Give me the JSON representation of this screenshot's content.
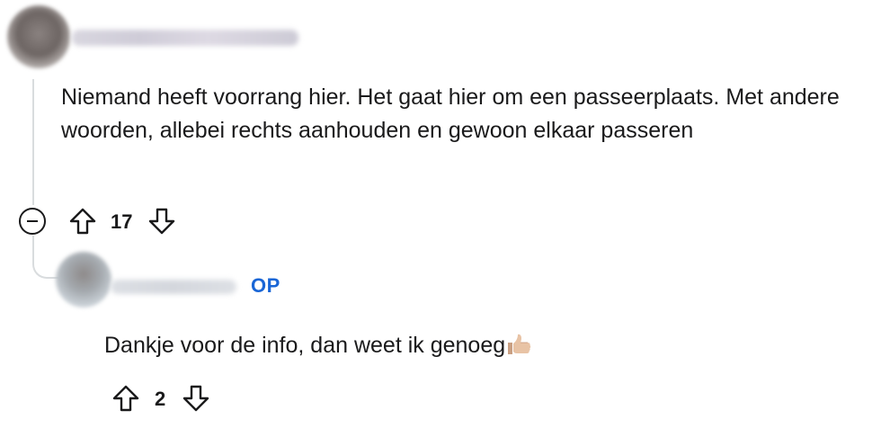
{
  "comments": [
    {
      "text": "Niemand heeft voorrang hier. Het gaat hier om een passeerplaats. Met andere woorden, allebei rechts aanhouden en gewoon elkaar passeren",
      "score": "17"
    },
    {
      "badge": "OP",
      "text": "Dankje voor de info, dan weet ik genoeg",
      "emoji": "thumbs-up",
      "score": "2"
    }
  ],
  "icons": {
    "collapse": "collapse-minus-icon",
    "upvote": "upvote-arrow-icon",
    "downvote": "downvote-arrow-icon"
  },
  "colors": {
    "op_badge": "#1a66d6",
    "thread_line": "#d9dcde",
    "text": "#1a1a1b"
  }
}
